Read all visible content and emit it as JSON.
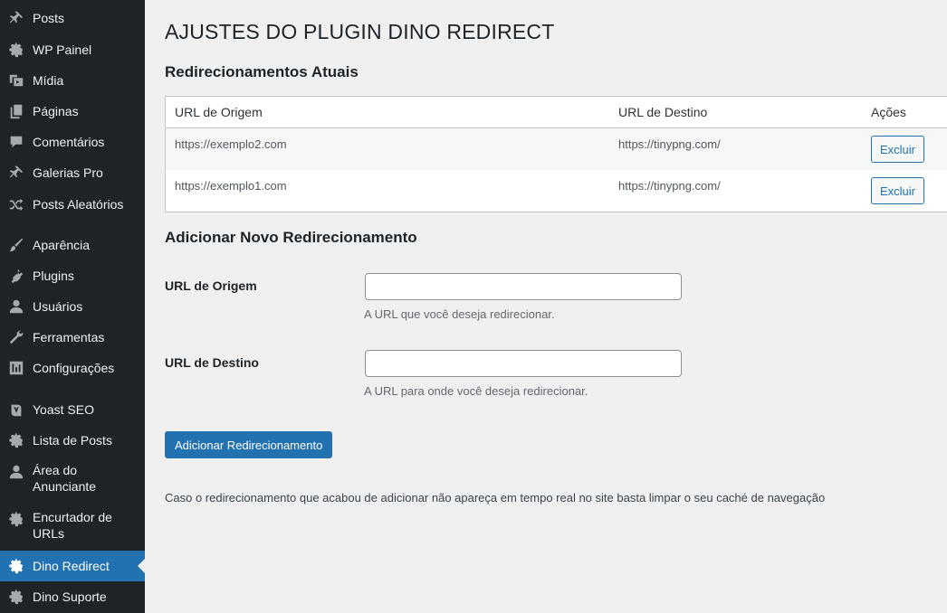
{
  "sidebar": {
    "items": [
      {
        "label": "Posts",
        "icon": "pin-icon"
      },
      {
        "label": "WP Painel",
        "icon": "gear-icon"
      },
      {
        "label": "Mídia",
        "icon": "media-icon"
      },
      {
        "label": "Páginas",
        "icon": "pages-icon"
      },
      {
        "label": "Comentários",
        "icon": "comment-icon"
      },
      {
        "label": "Galerias Pro",
        "icon": "pin-icon"
      },
      {
        "label": "Posts Aleatórios",
        "icon": "shuffle-icon"
      },
      {
        "label": "Aparência",
        "icon": "brush-icon"
      },
      {
        "label": "Plugins",
        "icon": "plugin-icon"
      },
      {
        "label": "Usuários",
        "icon": "user-icon"
      },
      {
        "label": "Ferramentas",
        "icon": "wrench-icon"
      },
      {
        "label": "Configurações",
        "icon": "settings-icon"
      },
      {
        "label": "Yoast SEO",
        "icon": "yoast-icon"
      },
      {
        "label": "Lista de Posts",
        "icon": "gear-icon"
      },
      {
        "label": "Área do Anunciante",
        "icon": "user-icon"
      },
      {
        "label": "Encurtador de URLs",
        "icon": "gear-icon"
      },
      {
        "label": "Dino Redirect",
        "icon": "gear-icon",
        "active": true
      },
      {
        "label": "Dino Suporte",
        "icon": "gear-icon"
      }
    ]
  },
  "page": {
    "title": "AJUSTES DO PLUGIN DINO REDIRECT",
    "current_heading": "Redirecionamentos Atuais",
    "table": {
      "headers": [
        "URL de Origem",
        "URL de Destino",
        "Ações"
      ],
      "rows": [
        {
          "origin": "https://exemplo2.com",
          "destination": "https://tinypng.com/",
          "action": "Excluir"
        },
        {
          "origin": "https://exemplo1.com",
          "destination": "https://tinypng.com/",
          "action": "Excluir"
        }
      ]
    },
    "add_heading": "Adicionar Novo Redirecionamento",
    "form": {
      "origin_label": "URL de Origem",
      "origin_value": "",
      "origin_desc": "A URL que você deseja redirecionar.",
      "dest_label": "URL de Destino",
      "dest_value": "",
      "dest_desc": "A URL para onde você deseja redirecionar."
    },
    "submit_label": "Adicionar Redirecionamento",
    "note": "Caso o redirecionamento que acabou de adicionar não apareça em tempo real no site basta limpar o seu caché de navegação"
  },
  "colors": {
    "sidebar_bg": "#1d2327",
    "accent": "#2271b1",
    "page_bg": "#f0f0f1"
  }
}
